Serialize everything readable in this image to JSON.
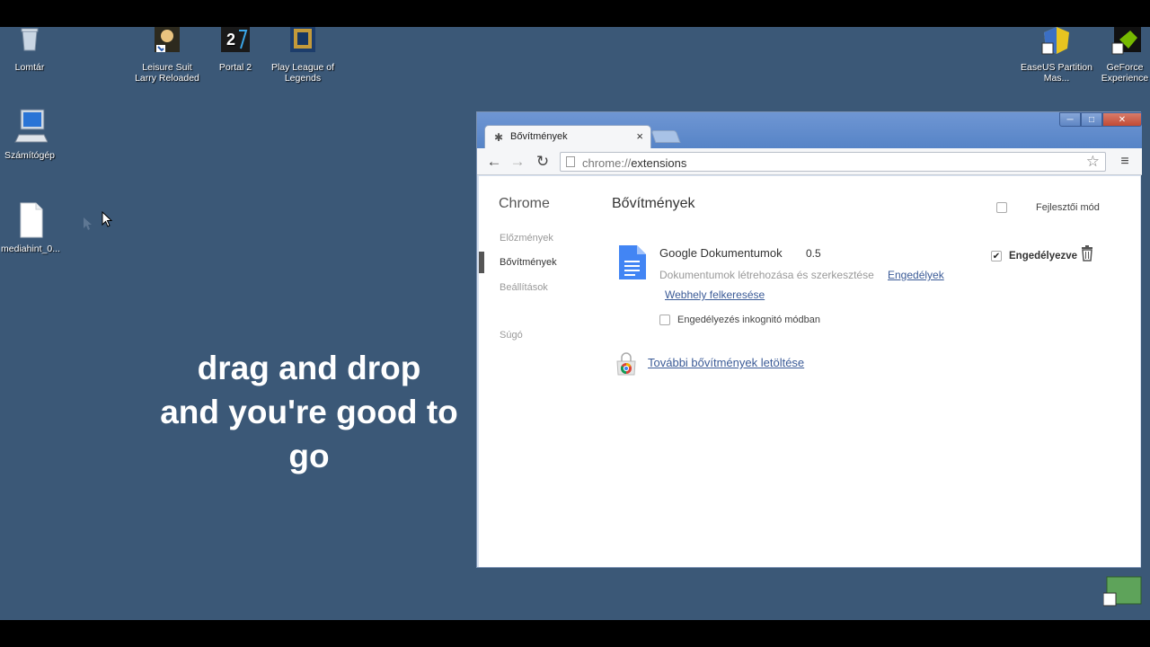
{
  "desktop": {
    "icons": [
      {
        "label": "Lomtár",
        "icon": "recycle-bin-icon"
      },
      {
        "label": "Leisure Suit Larry Reloaded",
        "icon": "game-shortcut-icon"
      },
      {
        "label": "Portal 2",
        "icon": "game-shortcut-icon"
      },
      {
        "label": "Play League of Legends",
        "icon": "game-shortcut-icon"
      },
      {
        "label": "EaseUS Partition Mas...",
        "icon": "app-shortcut-icon"
      },
      {
        "label": "GeForce Experience",
        "icon": "app-shortcut-icon"
      },
      {
        "label": "Számítógép",
        "icon": "computer-icon"
      },
      {
        "label": "mediahint_0...",
        "icon": "file-icon"
      }
    ],
    "overlay_text": [
      "drag and drop",
      "and you're good to",
      "go"
    ],
    "background_color": "#3b5877"
  },
  "browser": {
    "tab": {
      "title": "Bővítmények",
      "icon": "puzzle-icon",
      "close": "×"
    },
    "window_controls": {
      "minimize": "─",
      "maximize": "□",
      "close": "✕"
    },
    "toolbar": {
      "back": "←",
      "forward": "→",
      "reload": "↻",
      "url_scheme": "chrome://",
      "url_path": "extensions",
      "bookmark": "☆",
      "menu": "≡"
    },
    "sidebar": {
      "title": "Chrome",
      "items": [
        {
          "label": "Előzmények",
          "active": false
        },
        {
          "label": "Bővítmények",
          "active": true
        },
        {
          "label": "Beállítások",
          "active": false
        },
        {
          "label": "Súgó",
          "active": false
        }
      ]
    },
    "main": {
      "title": "Bővítmények",
      "dev_mode_label": "Fejlesztői mód",
      "dev_mode_checked": false,
      "extension": {
        "name": "Google Dokumentumok",
        "version": "0.5",
        "description": "Dokumentumok létrehozása és szerkesztése",
        "permissions_link": "Engedélyek",
        "website_link": "Webhely felkeresése",
        "incognito_label": "Engedélyezés inkognitó módban",
        "incognito_checked": false,
        "enabled_label": "Engedélyezve",
        "enabled_checked": true,
        "enabled_mark": "✔"
      },
      "more_extensions_link": "További bővítmények letöltése"
    },
    "colors": {
      "link": "#3b5b97",
      "title_bar": "#5f8bcc",
      "docs_blue": "#4285f4"
    }
  }
}
